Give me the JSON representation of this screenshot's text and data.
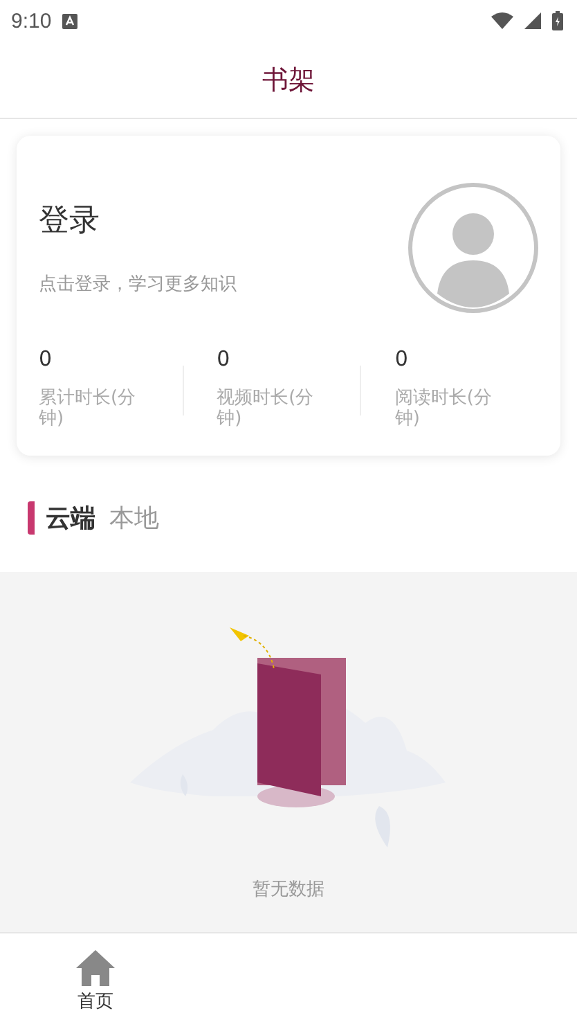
{
  "status_bar": {
    "time": "9:10"
  },
  "header": {
    "title": "书架"
  },
  "profile": {
    "title": "登录",
    "subtitle": "点击登录，学习更多知识",
    "stats": [
      {
        "value": "0",
        "label": "累计时长(分钟)"
      },
      {
        "value": "0",
        "label": "视频时长(分钟)"
      },
      {
        "value": "0",
        "label": "阅读时长(分钟)"
      }
    ]
  },
  "tabs": [
    {
      "label": "云端",
      "selected": true
    },
    {
      "label": "本地",
      "selected": false
    }
  ],
  "empty_state": {
    "text": "暂无数据"
  },
  "bottom_nav": [
    {
      "label": "首页",
      "selected": false
    }
  ]
}
